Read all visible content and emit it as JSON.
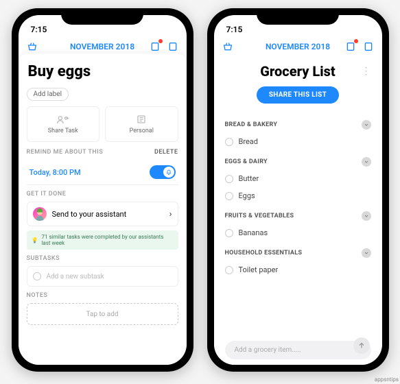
{
  "status": {
    "time": "7:15"
  },
  "nav": {
    "title": "NOVEMBER 2018"
  },
  "task": {
    "title": "Buy eggs",
    "add_label": "Add label",
    "tile_share": "Share Task",
    "tile_personal": "Personal",
    "remind_header": "REMIND ME ABOUT THIS",
    "delete": "DELETE",
    "remind_time": "Today, 8:00 PM",
    "get_it_done": "GET IT DONE",
    "assistant_text": "Send to your assistant",
    "banner": "71 similar tasks were completed by our assistants last week",
    "subtasks_header": "SUBTASKS",
    "subtask_placeholder": "Add a new subtask",
    "notes_header": "NOTES",
    "notes_placeholder": "Tap to add"
  },
  "list": {
    "title": "Grocery List",
    "share_button": "SHARE THIS LIST",
    "categories": [
      {
        "name": "BREAD & BAKERY",
        "items": [
          "Bread"
        ]
      },
      {
        "name": "EGGS & DAIRY",
        "items": [
          "Butter",
          "Eggs"
        ]
      },
      {
        "name": "FRUITS & VEGETABLES",
        "items": [
          "Bananas"
        ]
      },
      {
        "name": "HOUSEHOLD ESSENTIALS",
        "items": [
          "Toilet paper"
        ]
      }
    ],
    "add_placeholder": "Add a grocery item....."
  },
  "watermark": "appsntips"
}
